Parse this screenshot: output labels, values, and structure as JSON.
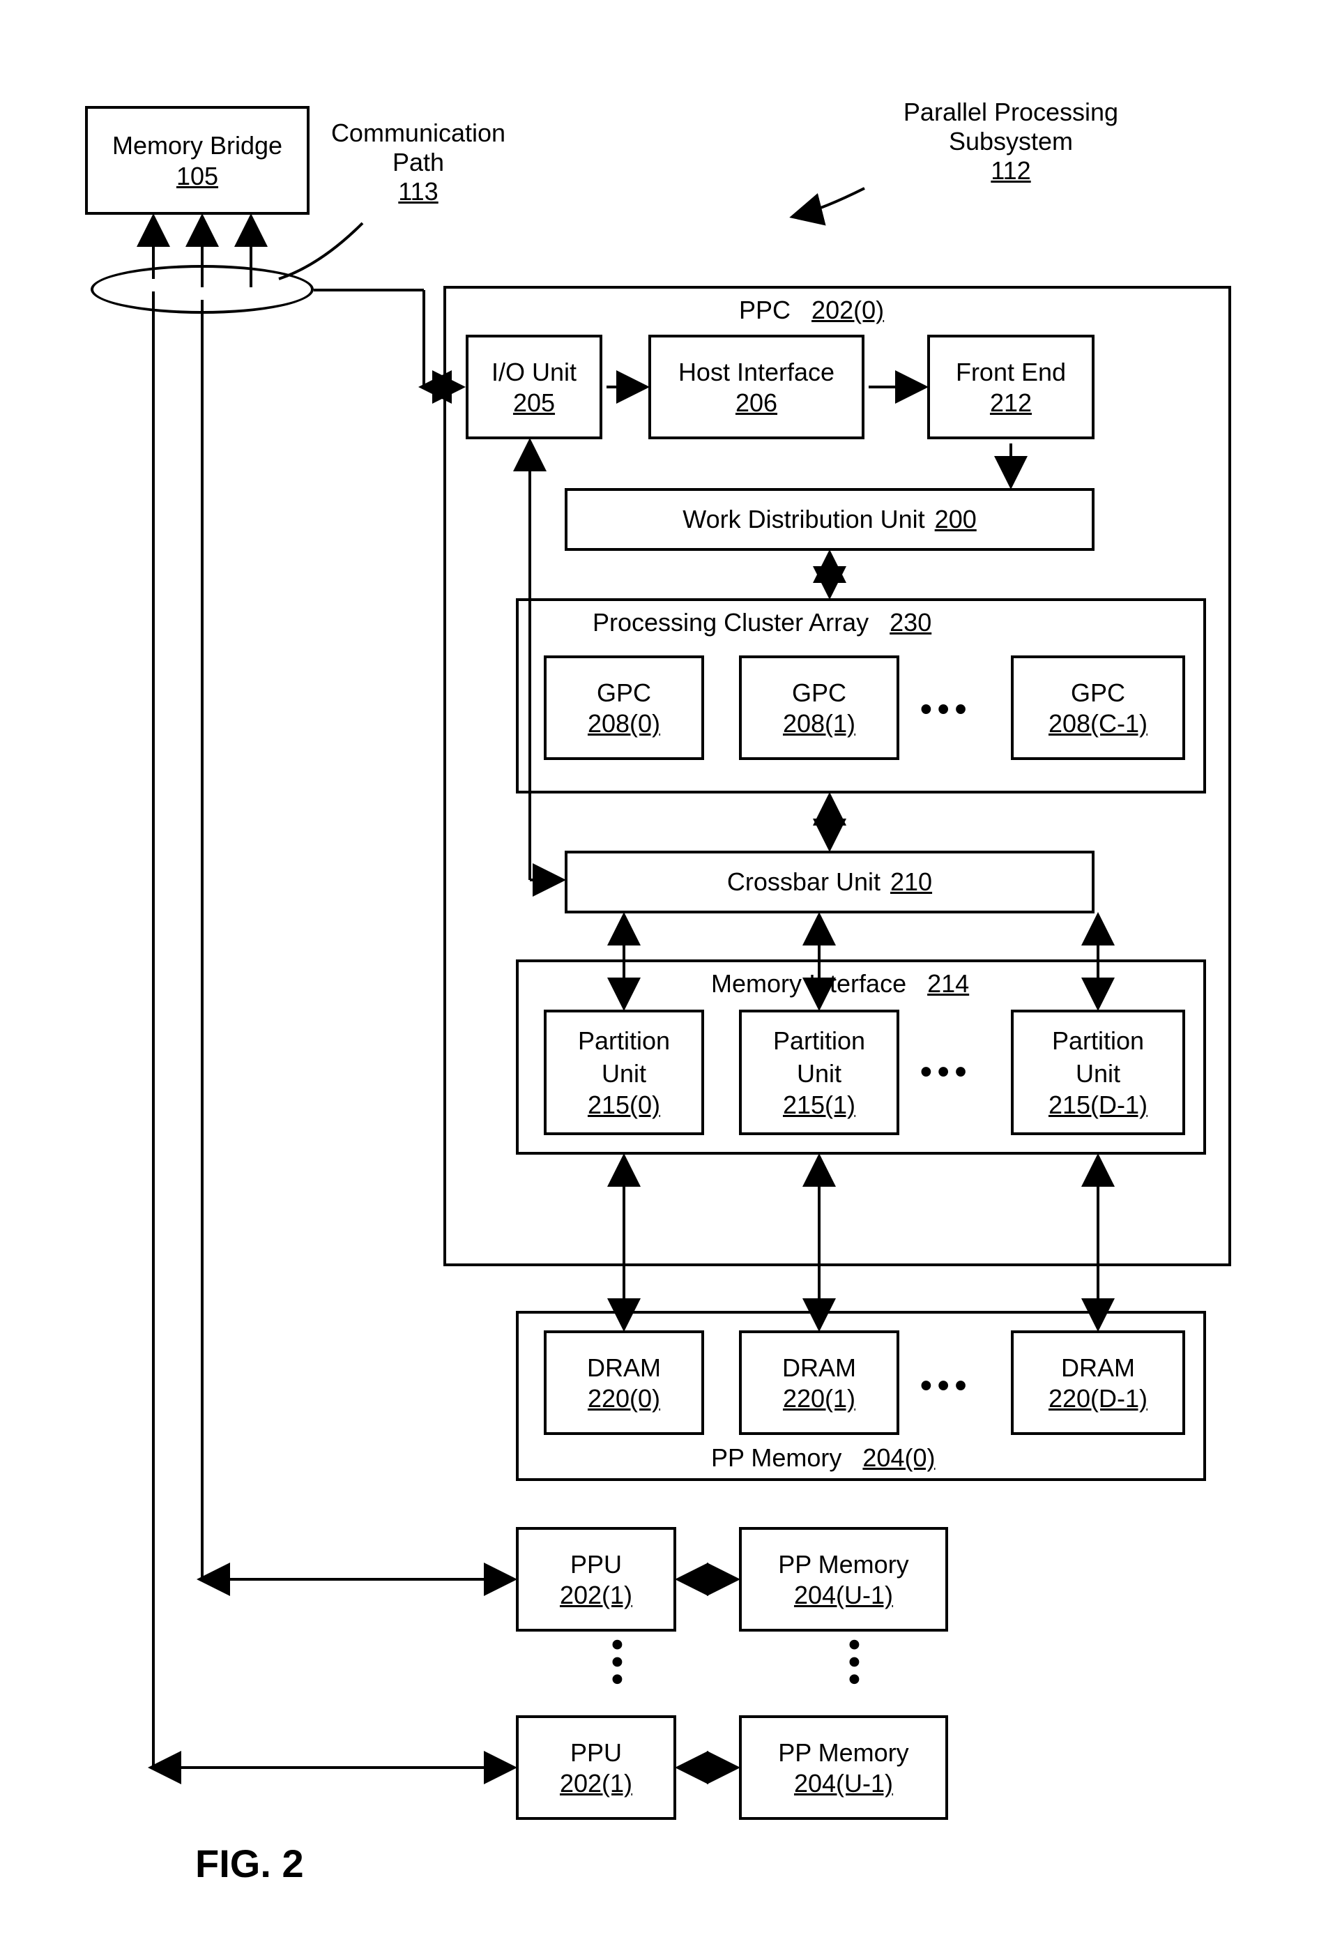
{
  "figure_label": "FIG. 2",
  "memory_bridge": {
    "label": "Memory Bridge",
    "ref": "105"
  },
  "comm_path": {
    "label": "Communication\nPath",
    "ref": "113"
  },
  "pp_subsystem": {
    "label": "Parallel Processing\nSubsystem",
    "ref": "112"
  },
  "ppc": {
    "label": "PPC",
    "ref": "202(0)"
  },
  "io_unit": {
    "label": "I/O Unit",
    "ref": "205"
  },
  "host_interface": {
    "label": "Host Interface",
    "ref": "206"
  },
  "front_end": {
    "label": "Front End",
    "ref": "212"
  },
  "work_dist": {
    "label": "Work Distribution Unit",
    "ref": "200"
  },
  "pca": {
    "label": "Processing Cluster Array",
    "ref": "230"
  },
  "gpc0": {
    "label": "GPC",
    "ref": "208(0)"
  },
  "gpc1": {
    "label": "GPC",
    "ref": "208(1)"
  },
  "gpcC": {
    "label": "GPC",
    "ref": "208(C-1)"
  },
  "crossbar": {
    "label": "Crossbar Unit",
    "ref": "210"
  },
  "mem_iface": {
    "label": "Memory Interface",
    "ref": "214"
  },
  "part0": {
    "label": "Partition\nUnit",
    "ref": "215(0)"
  },
  "part1": {
    "label": "Partition\nUnit",
    "ref": "215(1)"
  },
  "partD": {
    "label": "Partition\nUnit",
    "ref": "215(D-1)"
  },
  "dram0": {
    "label": "DRAM",
    "ref": "220(0)"
  },
  "dram1": {
    "label": "DRAM",
    "ref": "220(1)"
  },
  "dramD": {
    "label": "DRAM",
    "ref": "220(D-1)"
  },
  "pp_mem0": {
    "label": "PP Memory",
    "ref": "204(0)"
  },
  "ppu1": {
    "label": "PPU",
    "ref": "202(1)"
  },
  "pp_mem1": {
    "label": "PP Memory",
    "ref": "204(U-1)"
  },
  "ppu2": {
    "label": "PPU",
    "ref": "202(1)"
  },
  "pp_mem2": {
    "label": "PP Memory",
    "ref": "204(U-1)"
  }
}
